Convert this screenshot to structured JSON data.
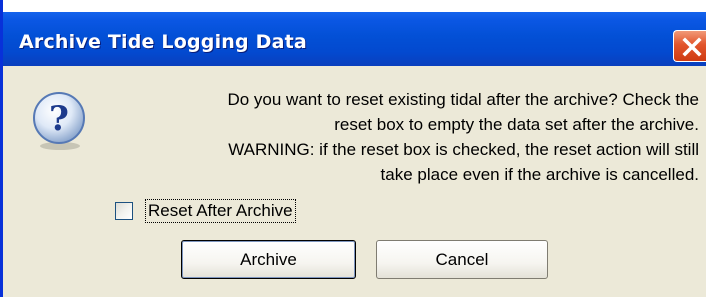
{
  "dialog": {
    "title": "Archive Tide Logging Data",
    "close_icon": "close-icon",
    "message_icon": "question-icon",
    "message_lines": [
      "Do you want to reset existing tidal after the archive? Check the",
      "reset box to empty the data set after the archive.",
      "WARNING: if the reset box is checked, the reset action will still",
      "take place even if the archive is cancelled."
    ],
    "checkbox": {
      "label": "Reset After Archive",
      "checked": false
    },
    "buttons": {
      "archive_label": "Archive",
      "cancel_label": "Cancel"
    }
  }
}
